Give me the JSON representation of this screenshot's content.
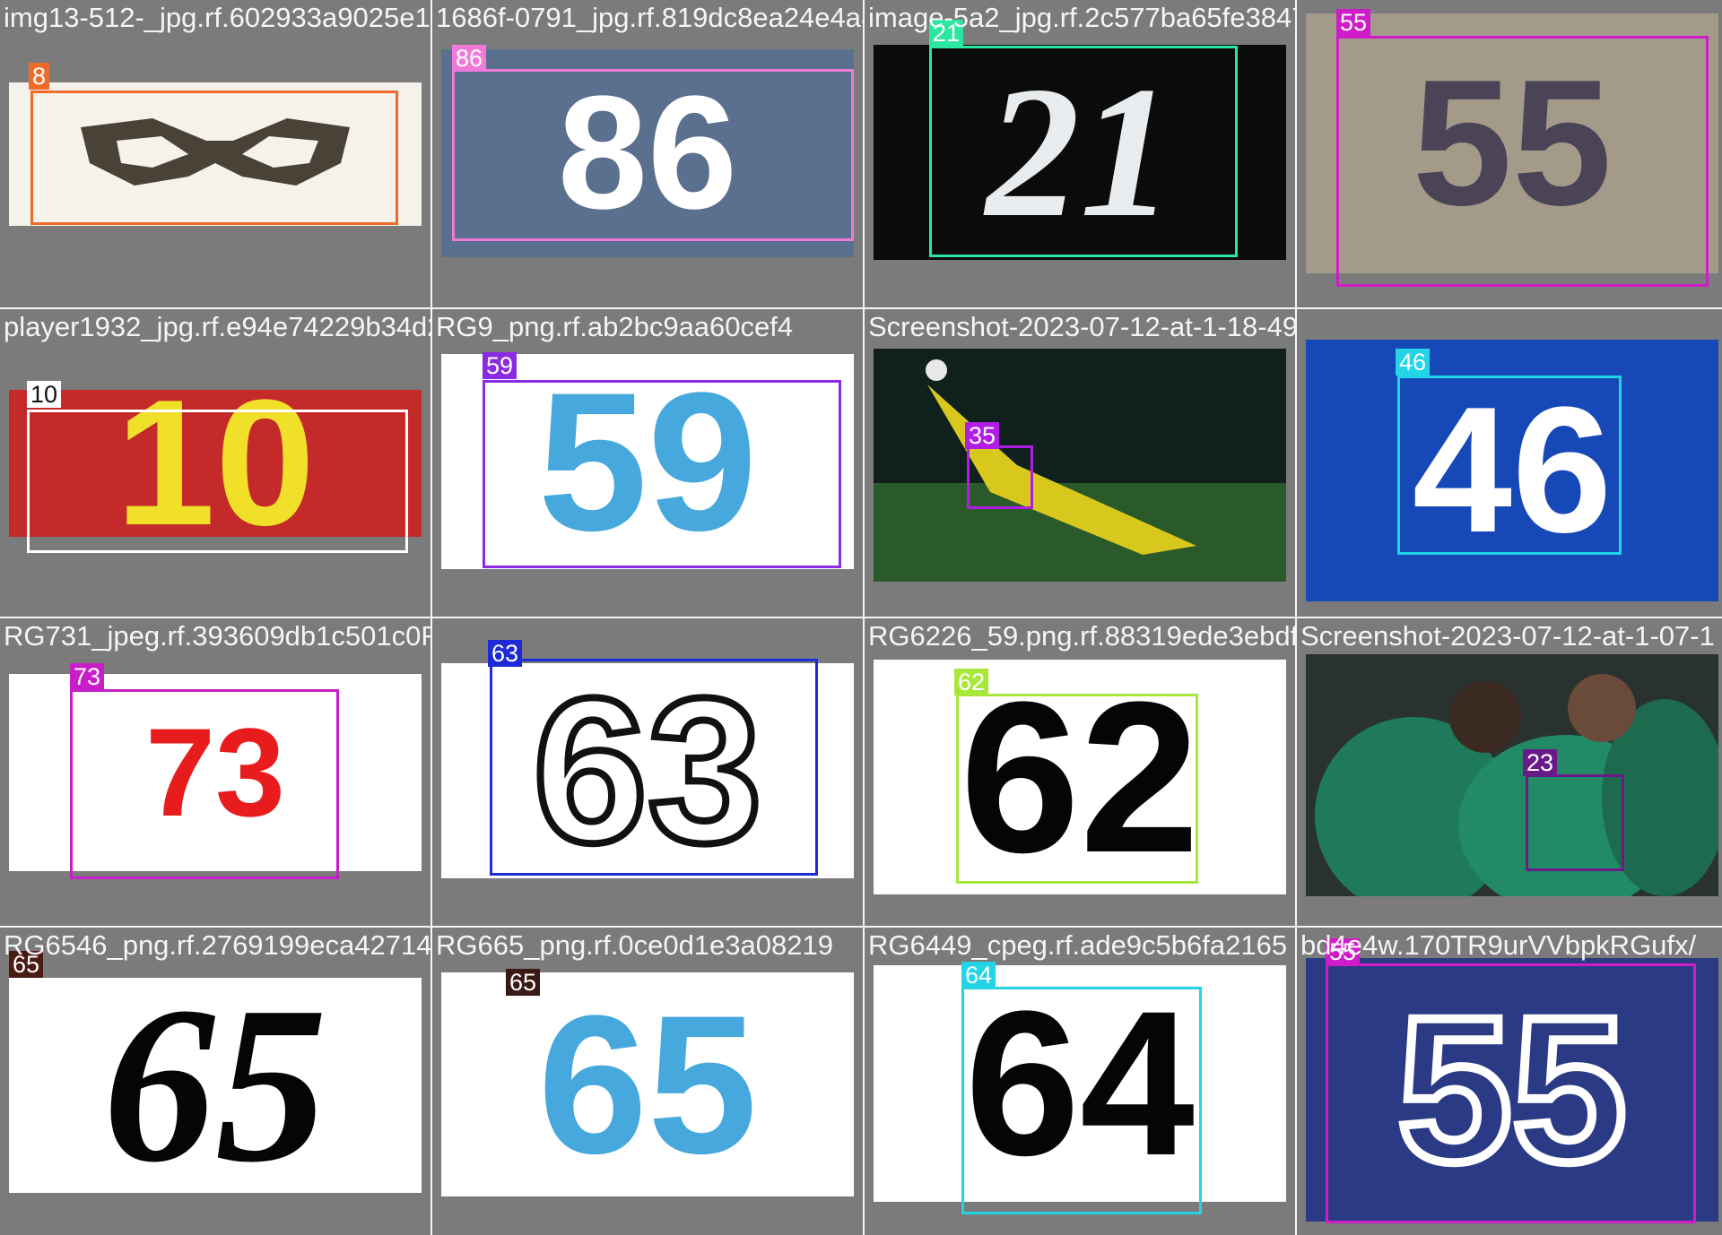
{
  "tiles": [
    {
      "filename": "img13-512-_jpg.rf.602933a9025e1fadef1e",
      "label": "8",
      "color": "#f06a2a",
      "image_desc": "glasses-shape digit on white",
      "digits": ""
    },
    {
      "filename": "1686f-0791_jpg.rf.819dc8ea24e4a80c84cd05910",
      "label": "86",
      "color": "#f07ad8",
      "image_desc": "white number on blue cloth",
      "digits": "86"
    },
    {
      "filename": "image-5a2_jpg.rf.2c577ba65fe3847f4c4220fe09d036276a5a88c0",
      "label": "21",
      "color": "#2ae6a0",
      "image_desc": "white numerals on black",
      "digits": "21"
    },
    {
      "filename": "",
      "label": "55",
      "color": "#d01cc8",
      "image_desc": "faded handwritten digits",
      "digits": "55"
    },
    {
      "filename": "player1932_jpg.rf.e94e74229b34d2GT5045 19",
      "label": "10",
      "color": "#ffffff",
      "image_desc": "yellow digits on red",
      "digits": "10"
    },
    {
      "filename": "RG9_png.rf.ab2bc9aa60cef4",
      "label": "59",
      "color": "#8a2be2",
      "image_desc": "light blue digits on white",
      "digits": "59"
    },
    {
      "filename": "Screenshot-2023-07-12-at-1-18-49-PM_png.rf.018bb700b8ab02d82",
      "label": "35",
      "color": "#b01ee6",
      "image_desc": "goalkeeper diving",
      "digits": ""
    },
    {
      "filename": "",
      "label": "46",
      "color": "#22d4e6",
      "image_desc": "white number on blue sign",
      "digits": "46"
    },
    {
      "filename": "RG731_jpeg.rf.393609db1c501c0RG6329a7dd2.rf.dbd3c5317bd188d",
      "label": "73",
      "color": "#c81ec8",
      "image_desc": "red sign with 73",
      "digits": "73"
    },
    {
      "filename": "",
      "label": "63",
      "color": "#1e2ad8",
      "image_desc": "outlined 63",
      "digits": "63"
    },
    {
      "filename": "RG6226_59.png.rf.88319ede3ebdf4b",
      "label": "62",
      "color": "#a8e83a",
      "image_desc": "black 62 on white",
      "digits": "62"
    },
    {
      "filename": "Screenshot-2023-07-12-at-1-07-1",
      "label": "23",
      "color": "#6a1a8a",
      "image_desc": "players celebrating",
      "digits": ""
    },
    {
      "filename": "RG6546_png.rf.2769199eca42714",
      "label": "65",
      "color": "#4a1a14",
      "image_desc": "black italic 65",
      "digits": "65"
    },
    {
      "filename": "RG665_png.rf.0ce0d1e3a08219",
      "label": "65",
      "color": "#3a1a14",
      "image_desc": "blue 65",
      "digits": "65"
    },
    {
      "filename": "RG6449_cpeg.rf.ade9c5b6fa2165",
      "label": "64",
      "color": "#22d4e6",
      "image_desc": "black 64",
      "digits": "64"
    },
    {
      "filename": "bd4e4w.170TR9urVVbpkRGufx/",
      "label": "55",
      "color": "#d01cc8",
      "image_desc": "white 55 on navy",
      "digits": "55"
    }
  ]
}
